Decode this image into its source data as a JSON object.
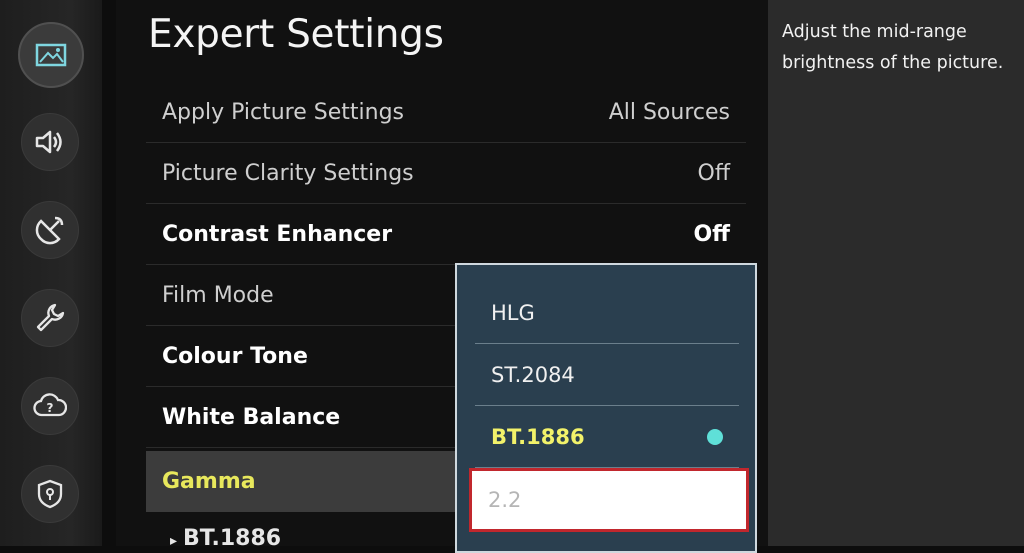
{
  "sidebar": {
    "icons": [
      "picture-icon",
      "sound-icon",
      "broadcast-icon",
      "wrench-icon",
      "support-cloud-icon",
      "privacy-shield-icon"
    ],
    "active_index": 0
  },
  "header": {
    "title": "Expert Settings"
  },
  "settings": [
    {
      "label": "Apply Picture Settings",
      "value": "All Sources"
    },
    {
      "label": "Picture Clarity Settings",
      "value": "Off"
    },
    {
      "label": "Contrast Enhancer",
      "value": "Off"
    },
    {
      "label": "Film Mode",
      "value": ""
    },
    {
      "label": "Colour Tone",
      "value": ""
    },
    {
      "label": "White Balance",
      "value": ""
    },
    {
      "label": "Gamma",
      "value": ""
    }
  ],
  "sub_item": {
    "label": "BT.1886"
  },
  "gamma_dropdown": {
    "options": [
      "HLG",
      "ST.2084",
      "BT.1886",
      "2.2"
    ],
    "current": "BT.1886",
    "focused": "2.2"
  },
  "help": {
    "text": "Adjust the mid-range brightness of the picture."
  },
  "colors": {
    "highlight_text": "#e8e85c",
    "dropdown_bg": "#2a3f4f",
    "focus_border": "#c1272d",
    "selected_dot": "#5fe0d8"
  }
}
